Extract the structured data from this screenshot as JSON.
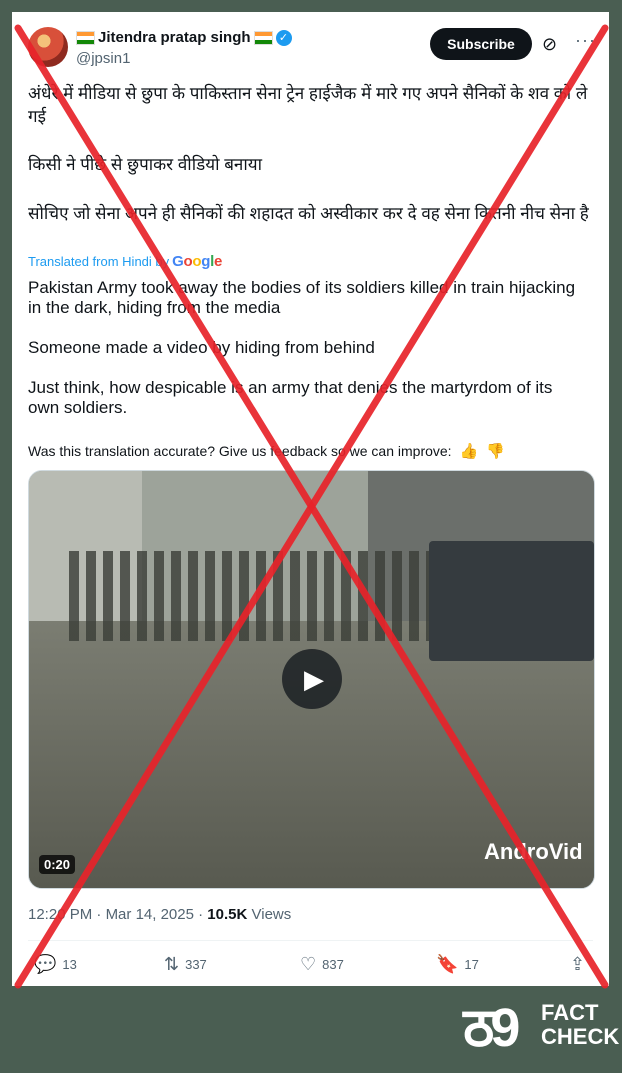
{
  "tweet": {
    "display_name": "Jitendra pratap singh",
    "handle": "@jpsin1",
    "subscribe_label": "Subscribe",
    "hindi_lines": [
      "अंधेरे में मीडिया से छुपा के पाकिस्तान सेना ट्रेन हाईजैक में मारे गए अपने सैनिकों के शव को ले गई",
      "किसी ने पीछे से छुपाकर वीडियो बनाया",
      "सोचिए जो सेना अपने ही सैनिकों की शहादत को अस्वीकार  कर दे वह सेना कितनी नीच सेना है"
    ],
    "translated_label": "Translated from Hindi by",
    "google_label": "Google",
    "translation_lines": [
      "Pakistan Army took away the bodies of its soldiers killed in train hijacking in the dark, hiding from the media",
      "Someone made a video by hiding from behind",
      "Just think, how despicable is an army that denies the martyrdom of its own soldiers."
    ],
    "feedback_text": "Was this translation accurate? Give us feedback so we can improve:",
    "video": {
      "duration": "0:20",
      "watermark": "AndroVid"
    },
    "time": "12:20 PM",
    "date": "Mar 14, 2025",
    "views_count": "10.5K",
    "views_label": "Views",
    "actions": {
      "replies": "13",
      "reposts": "337",
      "likes": "837",
      "bookmarks": "17"
    }
  },
  "brand": {
    "number": "ठ9",
    "fact": "FACT",
    "check": "CHECK"
  },
  "colors": {
    "background": "#4a5e52",
    "accent": "#1d9bf0",
    "cross": "#e8232a"
  },
  "icons": [
    "verified-badge-icon",
    "grok-icon",
    "more-icon",
    "thumbs-up-icon",
    "thumbs-down-icon",
    "play-icon",
    "reply-icon",
    "repost-icon",
    "like-icon",
    "bookmark-icon",
    "share-icon",
    "red-cross-mark"
  ]
}
